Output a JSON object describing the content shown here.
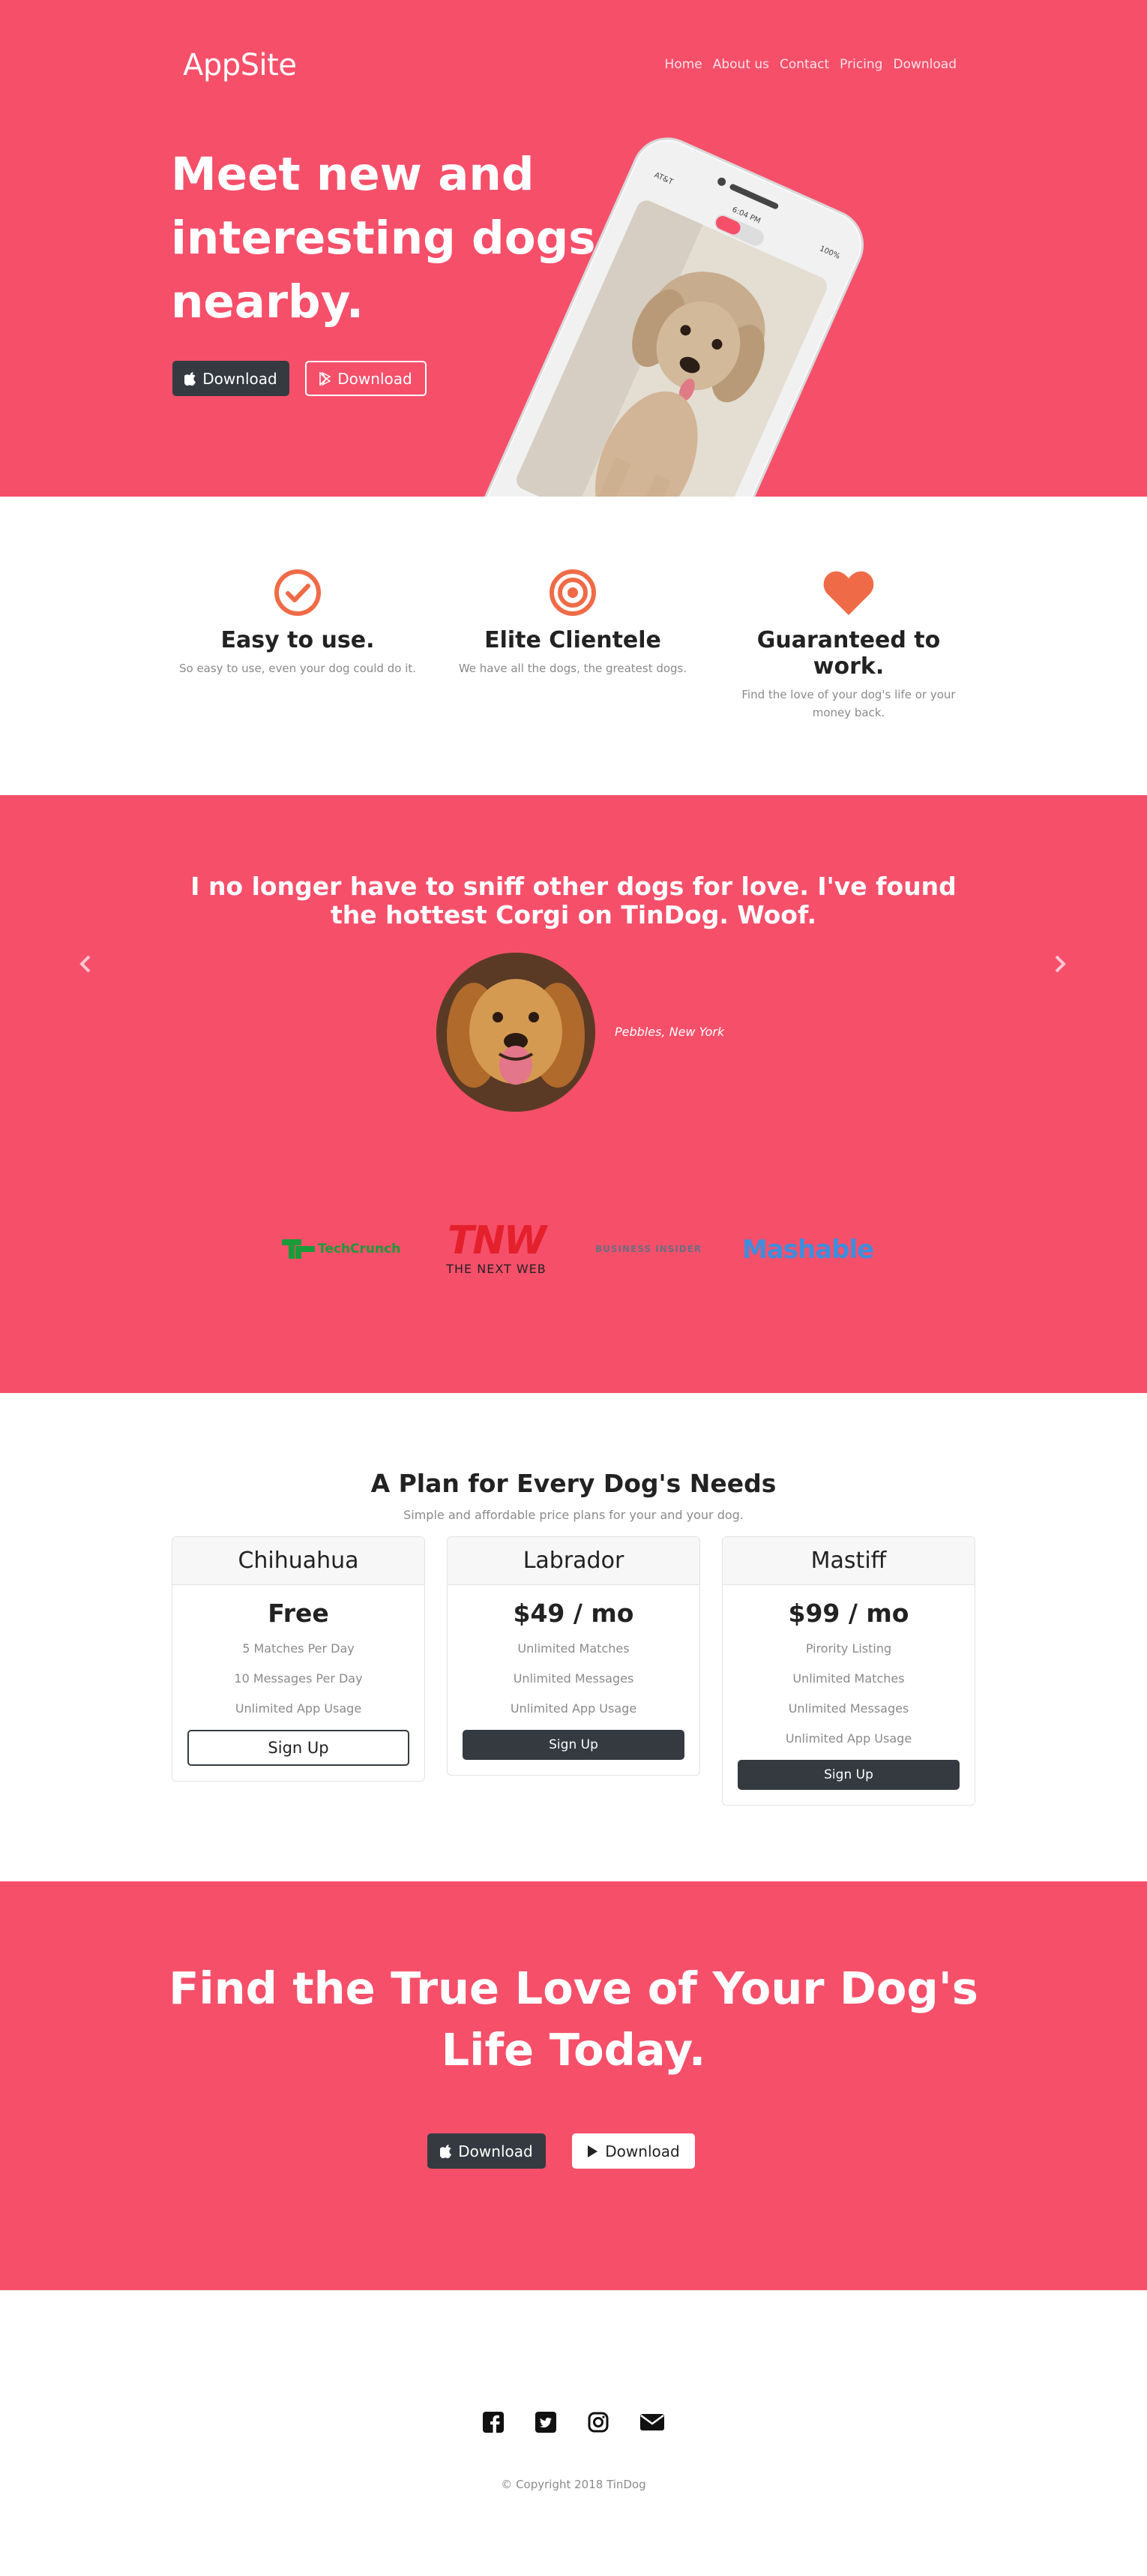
{
  "nav": {
    "brand": "AppSite",
    "links": [
      "Home",
      "About us",
      "Contact",
      "Pricing",
      "Download"
    ]
  },
  "hero": {
    "title_lines": [
      "Meet new and",
      "interesting dogs",
      "nearby."
    ],
    "download_apple": "Download",
    "download_google": "Download",
    "phone": {
      "carrier": "AT&T",
      "time": "6:04 PM",
      "battery": "100%"
    }
  },
  "features": [
    {
      "icon": "check-circle-icon",
      "title": "Easy to use.",
      "text": "So easy to use, even your dog could do it."
    },
    {
      "icon": "bullseye-icon",
      "title": "Elite Clientele",
      "text": "We have all the dogs, the greatest dogs."
    },
    {
      "icon": "heart-icon",
      "title": "Guaranteed to work.",
      "text": "Find the love of your dog's life or your money back."
    }
  ],
  "testimonial": {
    "quote": "I no longer have to sniff other dogs for love. I've found the hottest Corgi on TinDog. Woof.",
    "author": "Pebbles, New York"
  },
  "press": {
    "techcrunch": "TechCrunch",
    "tnw_logo": "TNW",
    "tnw_sub": "THE NEXT WEB",
    "business_insider": "BUSINESS INSIDER",
    "mashable": "Mashable"
  },
  "pricing": {
    "title": "A Plan for Every Dog's Needs",
    "subtitle": "Simple and affordable price plans for your and your dog.",
    "plans": [
      {
        "name": "Chihuahua",
        "price": "Free",
        "features": [
          "5 Matches Per Day",
          "10 Messages Per Day",
          "Unlimited App Usage"
        ],
        "cta": "Sign Up"
      },
      {
        "name": "Labrador",
        "price": "$49 / mo",
        "features": [
          "Unlimited Matches",
          "Unlimited Messages",
          "Unlimited App Usage"
        ],
        "cta": "Sign Up"
      },
      {
        "name": "Mastiff",
        "price": "$99 / mo",
        "features": [
          "Pirority Listing",
          "Unlimited Matches",
          "Unlimited Messages",
          "Unlimited App Usage"
        ],
        "cta": "Sign Up"
      }
    ]
  },
  "cta": {
    "title_lines": [
      "Find the True Love of Your Dog's",
      "Life Today."
    ],
    "download_apple": "Download",
    "download_google": "Download"
  },
  "footer": {
    "icons": [
      "facebook-icon",
      "twitter-icon",
      "instagram-icon",
      "envelope-icon"
    ],
    "copyright": "© Copyright 2018 TinDog"
  },
  "colors": {
    "primary_pink": "#f64f6a",
    "dark": "#343a40",
    "icon_orange": "#ef6b47"
  }
}
